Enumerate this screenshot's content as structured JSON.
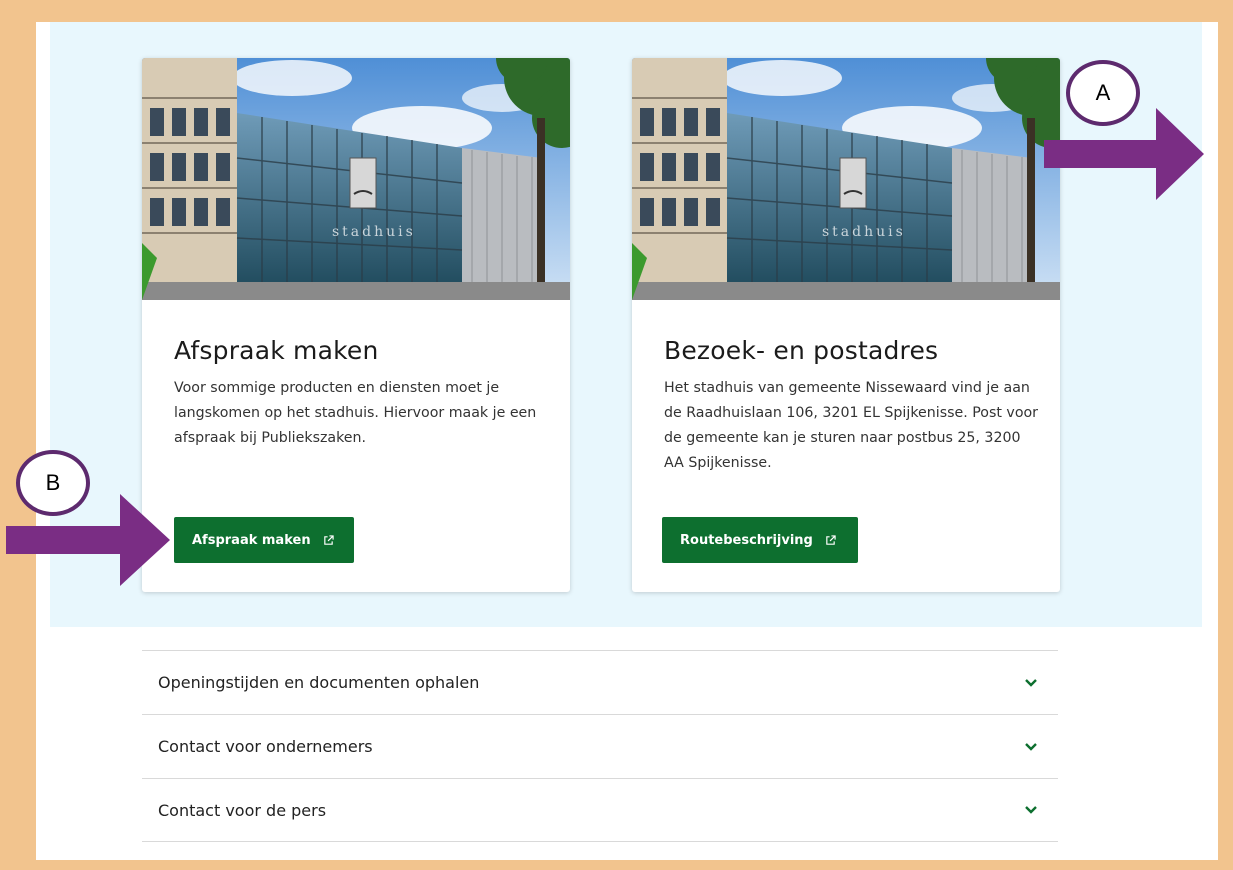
{
  "cards": [
    {
      "title": "Afspraak maken",
      "text": "Voor sommige producten en diensten moet je langskomen op het stadhuis. Hiervoor maak je een afspraak bij Publiekszaken.",
      "button_label": "Afspraak maken",
      "image_sign": "stadhuis"
    },
    {
      "title": "Bezoek- en postadres",
      "text": "Het stadhuis van gemeente Nissewaard vind je aan de Raadhuislaan 106, 3201 EL Spijkenisse. Post voor de gemeente kan je sturen naar postbus 25, 3200 AA Spijkenisse.",
      "button_label": "Routebeschrijving",
      "image_sign": "stadhuis"
    }
  ],
  "accordion": [
    {
      "label": "Openingstijden en documenten ophalen",
      "icon": "chevron-down-icon"
    },
    {
      "label": "Contact voor ondernemers",
      "icon": "chevron-down-icon"
    },
    {
      "label": "Contact voor de pers",
      "icon": "chevron-down-icon"
    }
  ],
  "annotations": {
    "a_label": "A",
    "b_label": "B"
  },
  "colors": {
    "button_green": "#0d6f2f",
    "hero_bg": "#e8f7fd",
    "frame_border": "#f2c48e",
    "annotation_purple": "#7a2d84"
  }
}
